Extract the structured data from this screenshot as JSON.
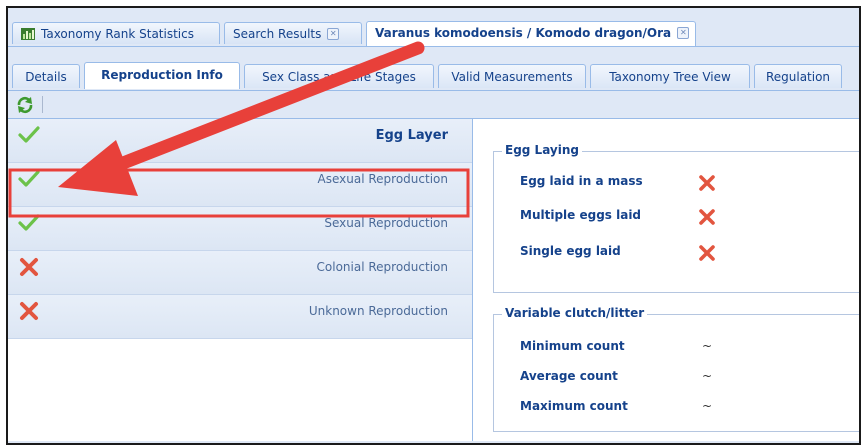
{
  "top_tabs": [
    {
      "label": "Taxonomy Rank Statistics",
      "active": false,
      "closable": false,
      "icon": "chart-icon"
    },
    {
      "label": "Search Results",
      "active": false,
      "closable": true
    },
    {
      "label": "Varanus komodoensis / Komodo dragon/Ora",
      "active": true,
      "closable": true
    }
  ],
  "sub_tabs": [
    {
      "label": "Details",
      "active": false
    },
    {
      "label": "Reproduction Info",
      "active": true
    },
    {
      "label": "Sex Class and Life Stages",
      "active": false
    },
    {
      "label": "Valid Measurements",
      "active": false
    },
    {
      "label": "Taxonomy Tree View",
      "active": false
    },
    {
      "label": "Regulation",
      "active": false
    }
  ],
  "toolbar": {
    "refresh_icon": "refresh-icon"
  },
  "reproduction_list": [
    {
      "label": "Egg Layer",
      "status": "check",
      "bold": true
    },
    {
      "label": "Asexual Reproduction",
      "status": "check",
      "bold": false,
      "highlighted": true
    },
    {
      "label": "Sexual Reproduction",
      "status": "check",
      "bold": false
    },
    {
      "label": "Colonial Reproduction",
      "status": "cross",
      "bold": false
    },
    {
      "label": "Unknown Reproduction",
      "status": "cross",
      "bold": false
    }
  ],
  "egg_laying": {
    "title": "Egg Laying",
    "items": [
      {
        "label": "Egg laid in a mass",
        "status": "cross"
      },
      {
        "label": "Multiple eggs laid",
        "status": "cross"
      },
      {
        "label": "Single egg laid",
        "status": "cross"
      }
    ]
  },
  "clutch": {
    "title": "Variable clutch/litter",
    "items": [
      {
        "label": "Minimum count",
        "value": "~"
      },
      {
        "label": "Average count",
        "value": "~"
      },
      {
        "label": "Maximum count",
        "value": "~"
      }
    ]
  },
  "colors": {
    "accent": "#15428b",
    "highlight_box": "#e8403a",
    "check": "#6cc24a",
    "cross": "#e2553f"
  }
}
